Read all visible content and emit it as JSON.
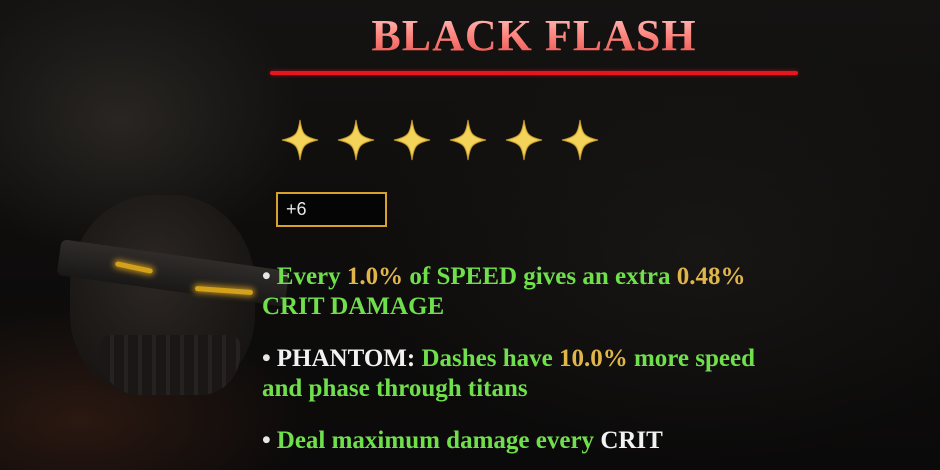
{
  "title": "BLACK FLASH",
  "stars": {
    "count": 6,
    "color": "#f3d35a",
    "icon": "four-point-star-icon"
  },
  "level": "+6",
  "colors": {
    "title": "#ff8a84",
    "rule": "#e8141e",
    "perk_text": "#6fe04b",
    "number": "#e0b64a",
    "keyword": "#f2f2f2",
    "level_border": "#d8a12c"
  },
  "perks": [
    {
      "bullet": "•",
      "part1": "Every ",
      "value1": "1.0%",
      "part2": " of SPEED gives an extra ",
      "value2": "0.48%",
      "part3": " CRIT DAMAGE"
    },
    {
      "bullet": "•",
      "keyword": "PHANTOM:",
      "part1": " Dashes have ",
      "value1": "10.0%",
      "part2": " more speed and phase through titans"
    },
    {
      "bullet": "•",
      "part1": "Deal maximum damage every ",
      "keyword": "CRIT"
    }
  ]
}
